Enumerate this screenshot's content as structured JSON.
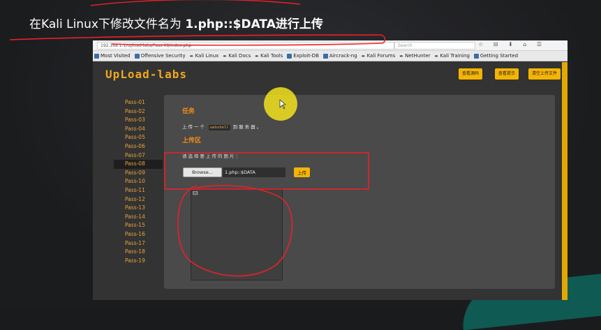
{
  "caption": {
    "prefix": "在Kali  Linux下修改文件名为 ",
    "bold": "1.php::$DATA进行上传"
  },
  "browser": {
    "url": "192.168.1.1/upload-labs/Pass-08/index.php",
    "search_placeholder": "Search",
    "toolbar_icons": "☆ ⊟ ⬇ ⌂ ☰"
  },
  "bookmarks": [
    {
      "label": "Most Visited",
      "icon": "firefox-icon"
    },
    {
      "label": "Offensive Security",
      "icon": "offsec-icon"
    },
    {
      "label": "Kali Linux",
      "icon": "kali-icon"
    },
    {
      "label": "Kali Docs",
      "icon": "kali-icon"
    },
    {
      "label": "Kali Tools",
      "icon": "kali-icon"
    },
    {
      "label": "Exploit-DB",
      "icon": "exploitdb-icon"
    },
    {
      "label": "Aircrack-ng",
      "icon": "aircrack-icon"
    },
    {
      "label": "Kali Forums",
      "icon": "kali-icon"
    },
    {
      "label": "NetHunter",
      "icon": "kali-icon"
    },
    {
      "label": "Kali Training",
      "icon": "kali-icon"
    },
    {
      "label": "Getting Started",
      "icon": "firefox-icon"
    }
  ],
  "site": {
    "logo": "UpLoad-labs",
    "buttons": [
      "查看源码",
      "查看提示",
      "清空上传文件"
    ]
  },
  "sidebar": {
    "items": [
      "Pass-01",
      "Pass-02",
      "Pass-03",
      "Pass-04",
      "Pass-05",
      "Pass-06",
      "Pass-07",
      "Pass-08",
      "Pass-09",
      "Pass-10",
      "Pass-11",
      "Pass-12",
      "Pass-13",
      "Pass-14",
      "Pass-15",
      "Pass-16",
      "Pass-17",
      "Pass-18",
      "Pass-19"
    ],
    "active_index": 7
  },
  "panel": {
    "task_title": "任务",
    "task_text_before": "上传一个",
    "task_code": "webshell",
    "task_text_after": "到服务器。",
    "upload_title": "上传区",
    "select_label": "请选择要上传的图片：",
    "browse_label": "Browse...",
    "file_name": "1.php::$DATA",
    "upload_label": "上传"
  },
  "colors": {
    "accent": "#f4b400",
    "title_orange": "#f28c1a",
    "annotation_red": "#e8212a"
  }
}
